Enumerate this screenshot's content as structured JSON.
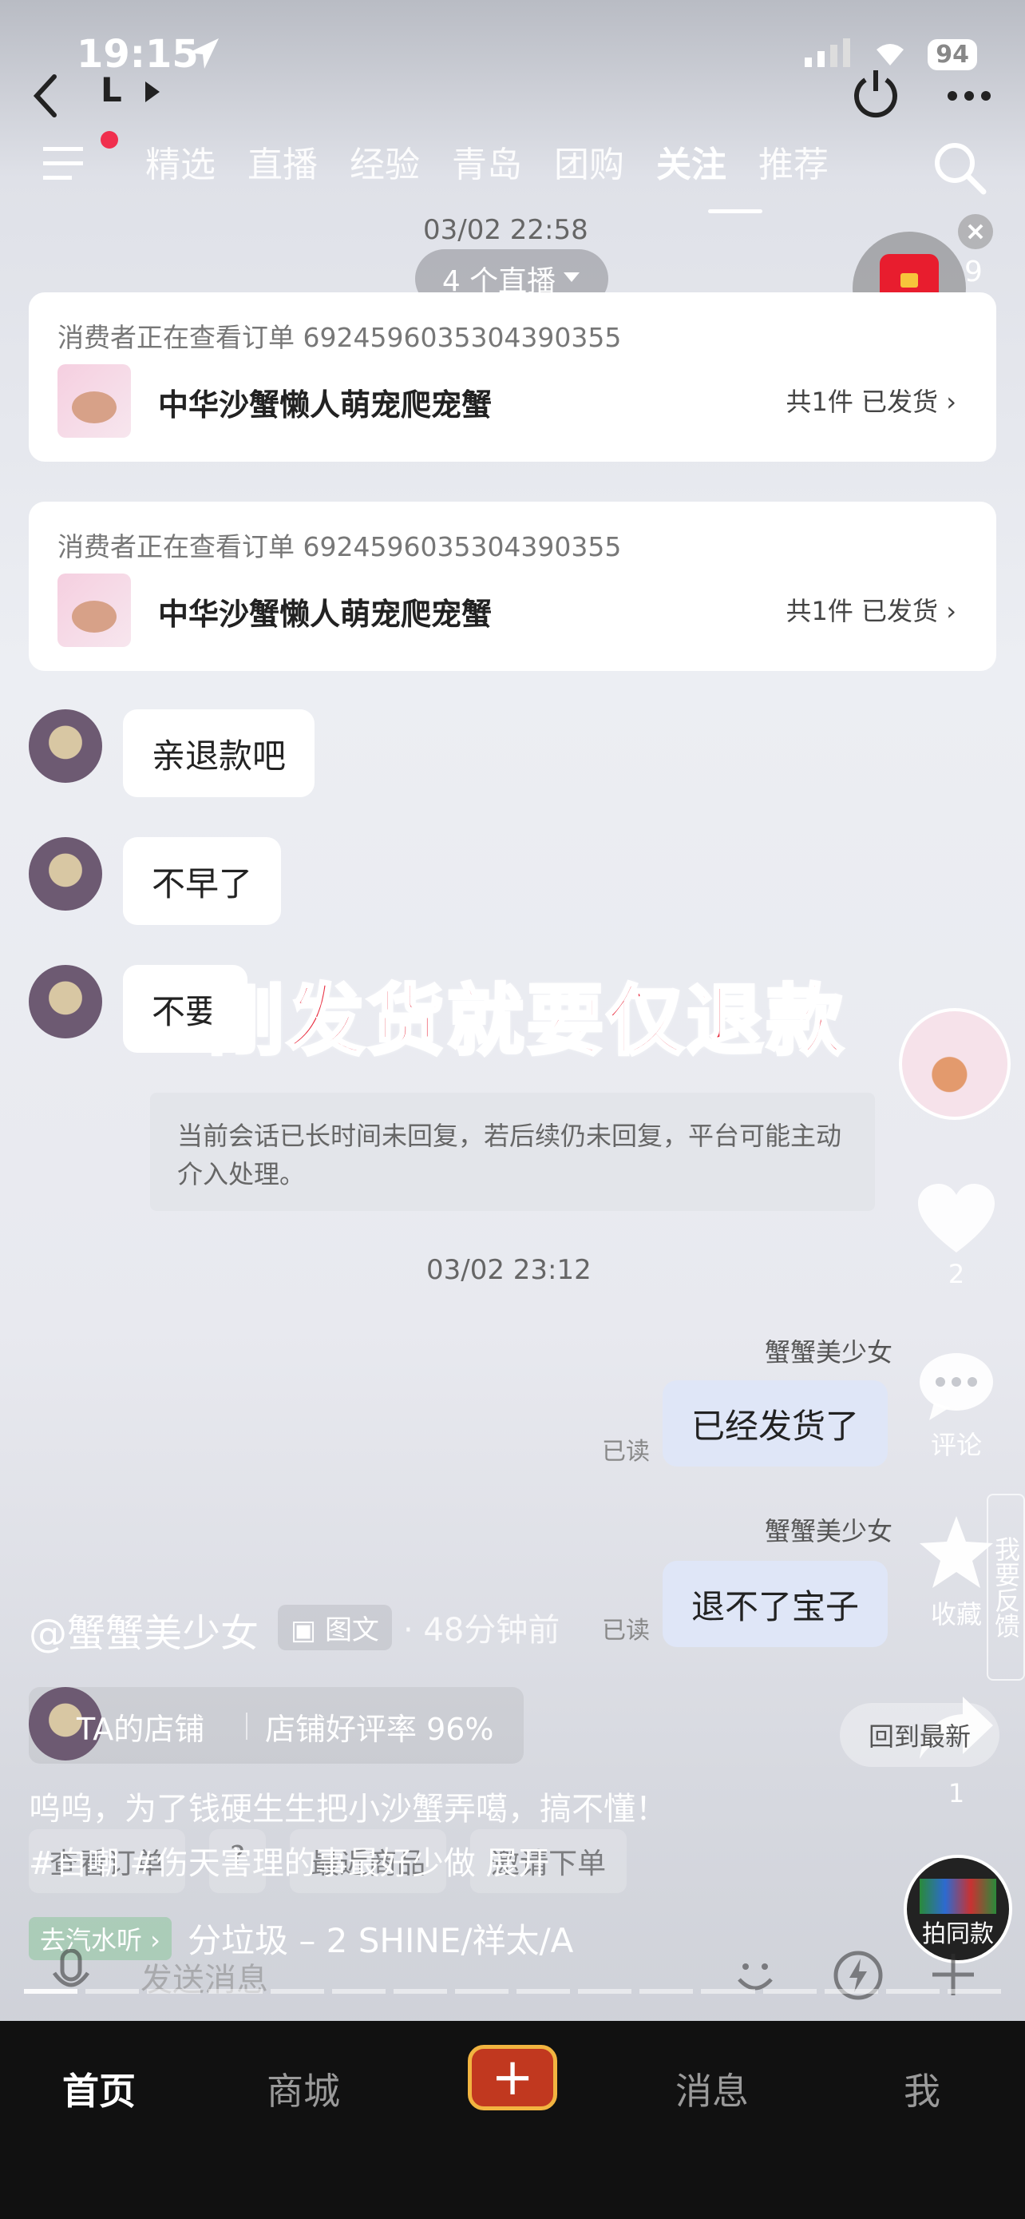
{
  "status": {
    "time": "19:15",
    "battery": "94",
    "subtitle": "L"
  },
  "nav": {
    "tabs": [
      "精选",
      "直播",
      "经验",
      "青岛",
      "团购",
      "关注",
      "推荐"
    ],
    "active_tab": "关注"
  },
  "chat": {
    "timestamp1": "03/02 22:58",
    "live_count": "4 个直播",
    "redpack_count": "9",
    "cards": [
      {
        "caption": "消费者正在查看订单 6924596035304390355",
        "product": "中华沙蟹懒人萌宠爬宠蟹",
        "status": "共1件  已发货"
      },
      {
        "caption": "消费者正在查看订单 6924596035304390355",
        "product": "中华沙蟹懒人萌宠爬宠蟹",
        "status": "共1件  已发货"
      }
    ],
    "messages_left": [
      "亲退款吧",
      "不早了",
      "不要"
    ],
    "overlay_title": "刚发货就要仅退款",
    "system_note": "当前会话已长时间未回复，若后续仍未回复，平台可能主动介入处理。",
    "timestamp2": "03/02 23:12",
    "sender_name": "蟹蟹美少女",
    "messages_right": [
      {
        "text": "已经发货了",
        "read": "已读"
      },
      {
        "text": "退不了宝子",
        "read": "已读"
      }
    ],
    "quick_actions": [
      "查看订单",
      "?",
      "最近商品",
      "邀请下单"
    ],
    "back_to_bottom": "回到最新",
    "input_placeholder": "发送消息"
  },
  "rail": {
    "likes": "2",
    "comment_label": "评论",
    "favorite_label": "收藏",
    "share_count": "1",
    "feedback_label": "我要反馈",
    "same_style_label": "拍同款"
  },
  "post": {
    "author": "@蟹蟹美少女",
    "type_label": "图文",
    "time_ago": "· 48分钟前",
    "shop_label": "TA的店铺",
    "shop_rating": "店铺好评率 96%",
    "description": "呜呜，为了钱硬生生把小沙蟹弄噶，搞不懂！",
    "tags": "#自嘲 #伤天害理的事最好少做  展开",
    "music_tag": "去汽水听 ›",
    "music": "分垃圾 – 2 SHINE/祥太/A"
  },
  "bottom_nav": {
    "items": [
      "首页",
      "商城",
      "消息",
      "我"
    ],
    "active": "首页"
  },
  "colors": {
    "overlay_red": "#e8283b",
    "bubble_me": "#dfe6f7",
    "plus_border": "#f2b440"
  }
}
